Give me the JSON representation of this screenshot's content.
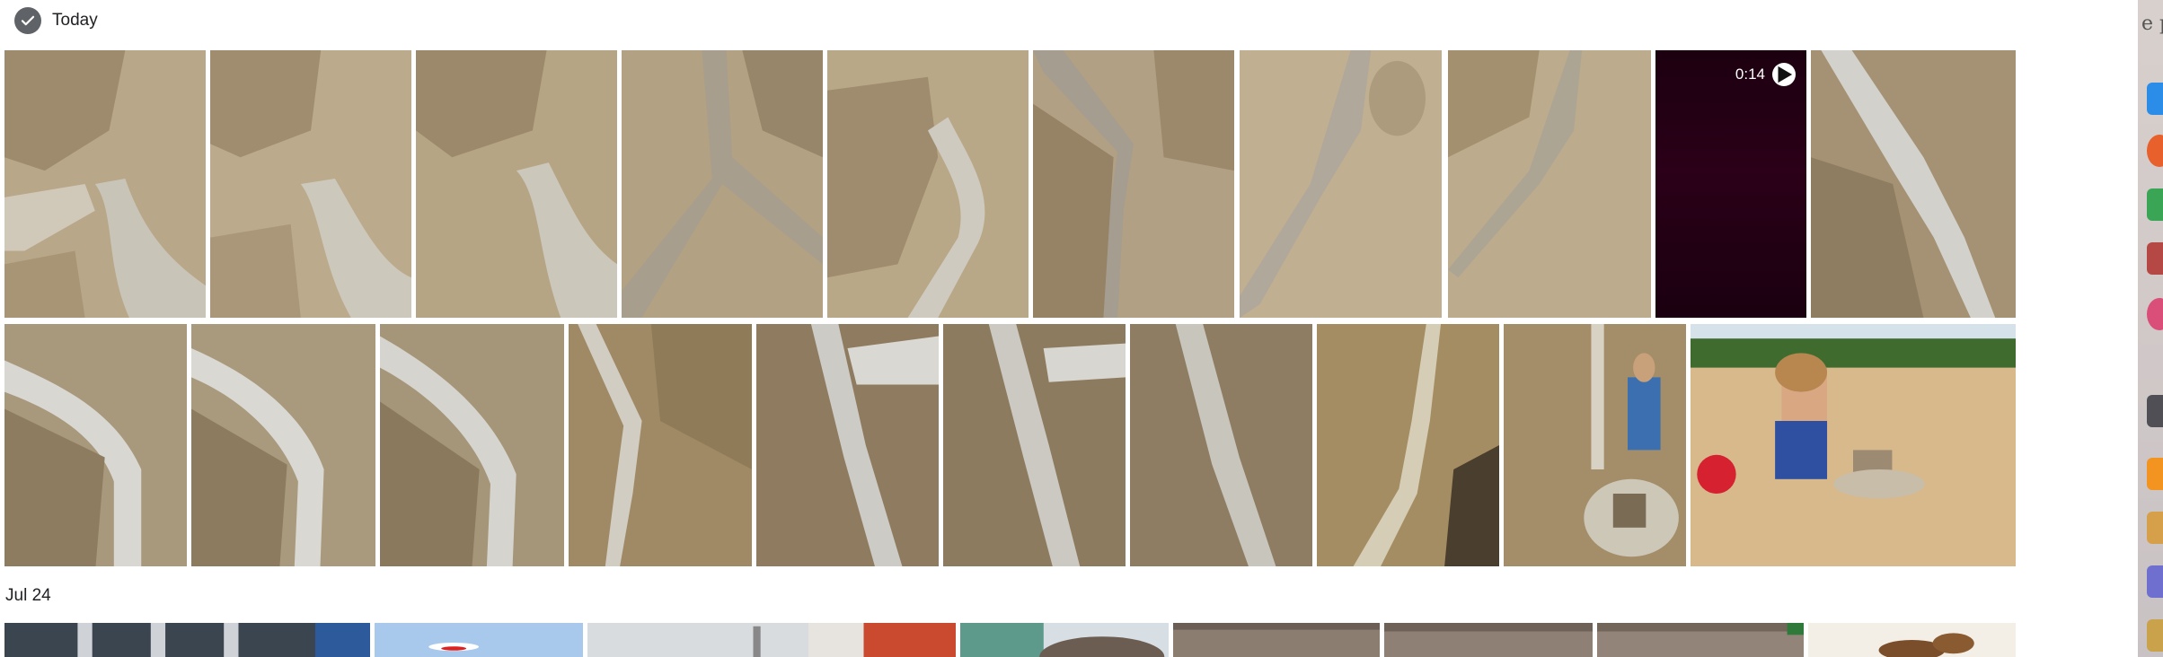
{
  "sections": {
    "today": {
      "title": "Today"
    },
    "jul24": {
      "title": "Jul 24"
    }
  },
  "video": {
    "duration": "0:14"
  },
  "desktop_edge": {
    "partial_text": "e p"
  },
  "icons": {
    "select_section": "check-circle-icon",
    "play": "play-icon"
  },
  "colors": {
    "sand": "#b9a98c",
    "video_bg": "#230015",
    "header_icon": "#5f6368"
  }
}
